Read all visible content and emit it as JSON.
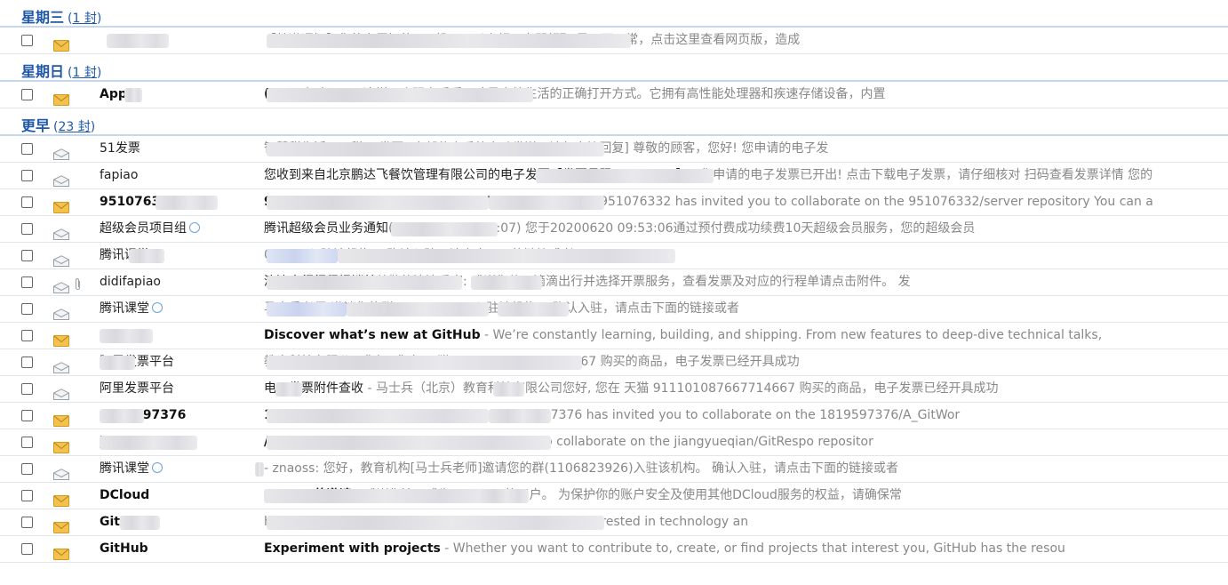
{
  "groups": [
    {
      "title": "星期三",
      "count_open": "(",
      "count": "1 封",
      "count_close": ")",
      "emails": [
        {
          "sender": "",
          "unread": true,
          "icon": "envelope-closed-icon",
          "subject": "",
          "preview": "【特邀通知】您的专属智能pos机已可以申领，立即领取 显示不正常，点击这里查看网页版，造成"
        }
      ]
    },
    {
      "title": "星期日",
      "count_open": "(",
      "count": "1 封",
      "count_close": ")",
      "emails": [
        {
          "sender": "Apple",
          "unread": true,
          "icon": "envelope-closed-icon",
          "subject": "(27)",
          "preview": " - 拥有 Mac 这样一个强力后盾，才是高校生活的正确打开方式。它拥有高性能处理器和疾速存储设备，内置"
        }
      ]
    },
    {
      "title": "更早",
      "count_open": "(",
      "count": "23 封",
      "count_close": ")",
      "emails": [
        {
          "sender": "51发票",
          "unread": false,
          "icon": "envelope-open-icon",
          "subject": "",
          "preview": "智慧税生活 | 云税51发票 [本邮件由系统自动发送，请勿直接回复] 尊敬的顾客，您好! 您申请的电子发"
        },
        {
          "sender": "fapiao",
          "unread": false,
          "icon": "envelope-open-icon",
          "subject": "您收到来自北京鹏达飞餐饮管理有限公司的电子发票【发票号码69429441】",
          "preview": " - 您申请的电子发票已开出! 点击下载电子发票，请仔细核对 扫码查看发票详情 您的"
        },
        {
          "sender": "951076332",
          "unread": true,
          "icon": "envelope-closed-icon",
          "subject": "951076332 invited you to 951076332/server",
          "preview": " - @951076332 has invited you to collaborate on the 951076332/server repository You can a"
        },
        {
          "sender": "超级会员项目组",
          "unread": false,
          "icon": "envelope-open-icon",
          "qq": true,
          "subject": "腾讯超级会员业务通知",
          "preview": "(20200620 09:53:07) 您于20200620 09:53:06通过预付费成功续费10天超级会员服务，您的超级会员"
        },
        {
          "sender": "腾讯课堂",
          "unread": false,
          "icon": "envelope-open-icon",
          "qq": true,
          "subject": "",
          "preview": "01069)入驻该机构。 确认入驻，请点击下面的链接或者"
        },
        {
          "sender": "didifapiao",
          "unread": false,
          "icon": "envelope-open-icon",
          "attach": true,
          "subject": "滴滴出行行程报销单",
          "preview": "尊敬的滴滴乘客: 感谢您使用滴滴出行并选择开票服务，查看发票及对应的行程单请点击附件。 发"
        },
        {
          "sender": "腾讯课堂",
          "unread": false,
          "icon": "envelope-open-icon",
          "qq": true,
          "subject": "",
          "preview": "马士兵老师]邀请您的群(981924337)入驻该机构。 确认入驻，请点击下面的链接或者"
        },
        {
          "sender": "GitHub",
          "unread": true,
          "icon": "envelope-closed-icon",
          "subject": "Discover what’s new at GitHub",
          "preview": " - We’re constantly learning, building, and shipping. From new features to deep-dive technical talks,"
        },
        {
          "sender": "阿里发票平台",
          "unread": false,
          "icon": "envelope-open-icon",
          "subject": "",
          "preview": "教育科技有限公司您好, 您在 天猫 911101087667714667 购买的商品，电子发票已经开具成功"
        },
        {
          "sender": "阿里发票平台",
          "unread": false,
          "icon": "envelope-open-icon",
          "subject": "电子发票附件查收",
          "preview": " - 马士兵（北京）教育科技有限公司您好, 您在 天猫 911101087667714667 购买的商品，电子发票已经开具成功"
        },
        {
          "sender": "1819597376",
          "unread": true,
          "icon": "envelope-closed-icon",
          "subject": "1819597376/A_GitWorkSpace2",
          "preview": " - @1819597376 has invited you to collaborate on the 1819597376/A_GitWor"
        },
        {
          "sender": "jiangyueqian",
          "unread": true,
          "icon": "envelope-closed-icon",
          "subject": "/GitRespo",
          "preview": " - @jiangyueqian has invited you to collaborate on the jiangyueqian/GitRespo repositor"
        },
        {
          "sender": "腾讯课堂",
          "unread": false,
          "icon": "envelope-open-icon",
          "qq": true,
          "subject": "",
          "preview": " - znaoss: 您好，教育机构[马士兵老师]邀请您的群(1106823926)入驻该机构。 确认入驻，请点击下面的链接或者"
        },
        {
          "sender": "DCloud",
          "unread": true,
          "icon": "envelope-closed-icon",
          "subject": "Builder的邀请",
          "preview": " - 感谢你注册成为HBuilder的用户。 为保护你的账户安全及使用其他DCloud服务的权益，请确保常"
        },
        {
          "sender": "GitHub",
          "unread": true,
          "icon": "envelope-closed-icon",
          "subject": "",
          "preview": "hat makes GitHub an amazing place for everyone interested in technology an"
        },
        {
          "sender": "GitHub",
          "unread": true,
          "icon": "envelope-closed-icon",
          "subject": "Experiment with projects",
          "preview": " - Whether you want to contribute to, create, or find projects that interest you, GitHub has the resou"
        }
      ]
    }
  ],
  "colors": {
    "group_title": "#1f58a8",
    "unread_envelope": "#f2c14e",
    "read_envelope": "#9aa0a8",
    "preview_text": "#888888"
  }
}
